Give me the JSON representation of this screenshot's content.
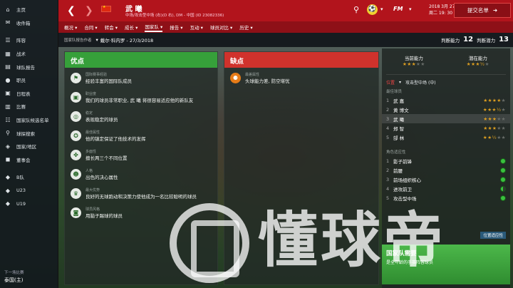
{
  "sidebar": {
    "items": [
      {
        "icon": "home-icon",
        "label": "主页"
      },
      {
        "icon": "inbox-icon",
        "label": "收件箱"
      },
      {
        "icon": "squad-icon",
        "label": "阵容"
      },
      {
        "icon": "tactics-icon",
        "label": "战术"
      },
      {
        "icon": "team-report-icon",
        "label": "球队报告"
      },
      {
        "icon": "staff-icon",
        "label": "职员"
      },
      {
        "icon": "schedule-icon",
        "label": "日程表"
      },
      {
        "icon": "competitions-icon",
        "label": "比赛"
      },
      {
        "icon": "national-squad-icon",
        "label": "国家队候选名单"
      },
      {
        "icon": "scouting-icon",
        "label": "球探搜索"
      },
      {
        "icon": "nation-icon",
        "label": "国家/地区"
      },
      {
        "icon": "board-icon",
        "label": "董事会"
      },
      {
        "icon": "b-team-icon",
        "label": "B队"
      },
      {
        "icon": "u23-icon",
        "label": "U23"
      },
      {
        "icon": "u19-icon",
        "label": "U19"
      }
    ],
    "footer_small": "下一场比赛",
    "footer_club": "泰国(主)"
  },
  "header": {
    "player_name": "武 曦",
    "player_sub": "中场/攻击型中场 (右)(D 右), DM - 中国 (ID 23082336)",
    "date_line1": "2018 3月 27",
    "date_line2": "周二 19: 30",
    "submit_label": "提交名单"
  },
  "tabs": [
    "概况",
    "合同",
    "转会",
    "成长",
    "国家队",
    "报告",
    "互动",
    "球员对比",
    "历史"
  ],
  "active_tab": "国家队",
  "subheader": {
    "scout_label": "国家队报告作者",
    "scout_value": "戴尔·科内罗 - 27/3/2018",
    "ability_label": "判断能力",
    "ability_value": "12",
    "potential_label": "判断潜力",
    "potential_value": "13"
  },
  "pros": {
    "title": "优点",
    "items": [
      {
        "icon": "flag-icon",
        "cat": "国际赛事经验",
        "desc": "经验丰富的国际队成员"
      },
      {
        "icon": "professional-icon",
        "cat": "职业度",
        "desc": "我们的球员非常职业, 武 曦 将很容易适应他的新队友"
      },
      {
        "icon": "target-icon",
        "cat": "稳定",
        "desc": "表现稳定的球员"
      },
      {
        "icon": "big-match-icon",
        "cat": "最佳属性",
        "desc": "他的镇定保证了他技术的发挥"
      },
      {
        "icon": "handshake-icon",
        "cat": "多面性",
        "desc": "擅长两三个不同位置"
      },
      {
        "icon": "personality-icon",
        "cat": "人格",
        "desc": "出色的决心属性"
      },
      {
        "icon": "trophy-icon",
        "cat": "最大优势",
        "desc": "良好的无球跑动和决策力使他成为一名比较聪明的球员"
      },
      {
        "icon": "playing-style-icon",
        "cat": "球员风格",
        "desc": "用脑子踢球的球员"
      }
    ]
  },
  "cons": {
    "title": "缺点",
    "items": [
      {
        "icon": "weakness-icon",
        "cat": "最差属性",
        "desc": "头球能力差, 防空堪忧"
      }
    ]
  },
  "right": {
    "current_ability_label": "当前能力",
    "current_stars": 3,
    "potential_ability_label": "潜在能力",
    "potential_stars": 3.5,
    "position_prefix": "位置",
    "position_value": "攻击型中场 (中)",
    "best_players_label": "最佳球员",
    "players": [
      {
        "n": "1",
        "name": "武 嘉",
        "stars": 4
      },
      {
        "n": "2",
        "name": "黄 博文",
        "stars": 3.5
      },
      {
        "n": "3",
        "name": "武 曦",
        "stars": 3
      },
      {
        "n": "4",
        "name": "郑 智",
        "stars": 3
      },
      {
        "n": "5",
        "name": "郜 林",
        "stars": 2.5
      }
    ],
    "roles_label": "角色适应性",
    "roles": [
      {
        "n": "1",
        "name": "影子前锋",
        "fit": "full"
      },
      {
        "n": "2",
        "name": "前腰",
        "fit": "full"
      },
      {
        "n": "3",
        "name": "前场组织核心",
        "fit": "full"
      },
      {
        "n": "4",
        "name": "进攻前卫",
        "fit": "half"
      },
      {
        "n": "5",
        "name": "攻击型中场",
        "fit": "full"
      }
    ],
    "more_label": "位置适应性",
    "bottom_title": "国家队需要",
    "bottom_sub": "是全年龄的手赛阵容球员"
  },
  "watermark": "懂球帝",
  "colors": {
    "brand_red": "#b2141c",
    "pros_green": "#36a03a",
    "cons_red": "#d0322c",
    "star_gold": "#e0a020"
  }
}
